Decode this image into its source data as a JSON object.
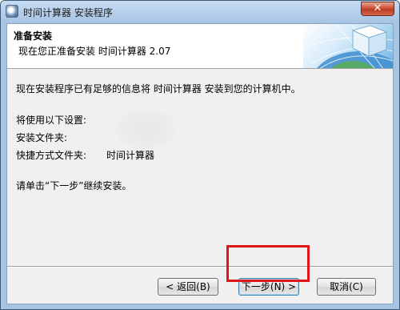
{
  "window": {
    "title": "时间计算器 安装程序",
    "close_glyph": "✕"
  },
  "header": {
    "title": "准备安装",
    "subtitle": "现在您正准备安装 时间计算器 2.07"
  },
  "body": {
    "intro": "现在安装程序已有足够的信息将 时间计算器 安装到您的计算机中。",
    "settings_heading": "将使用以下设置:",
    "install_folder_label": "安装文件夹:",
    "shortcut_folder_label": "快捷方式文件夹:",
    "shortcut_folder_value": "时间计算器",
    "instruction": "请单击“下一步”继续安装。"
  },
  "buttons": {
    "back": "< 返回(B)",
    "next": "下一步(N) >",
    "cancel": "取消(C)"
  },
  "colors": {
    "highlight": "#e0161a",
    "titlebar": "#a9c4e2"
  },
  "icons": {
    "app": "installer-disc-icon",
    "header_art": "globe-cube-icon"
  }
}
